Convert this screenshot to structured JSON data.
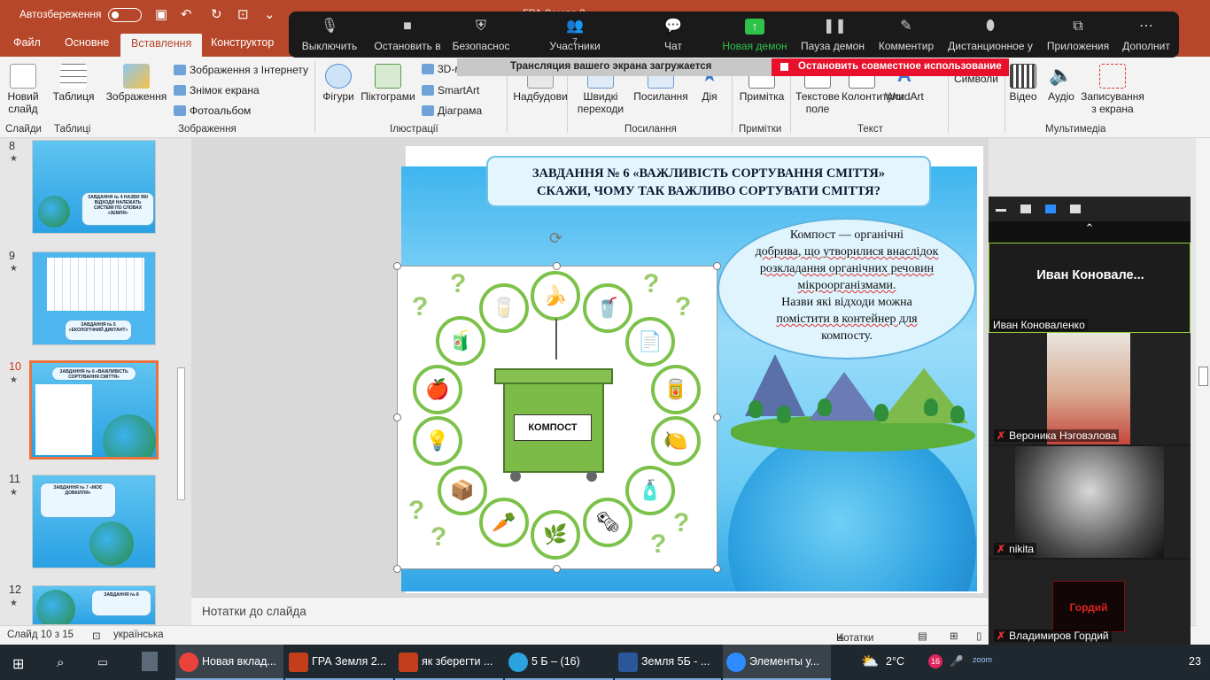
{
  "titlebar": {
    "autosave": "Автозбереження",
    "doc_title": "ГРА Земля 2..."
  },
  "tabs": [
    "Файл",
    "Основне",
    "Вставлення",
    "Конструктор"
  ],
  "ribbon": {
    "new_slide": "Новий слайд",
    "table": "Таблиця",
    "images": "Зображення",
    "online_images": "Зображення з Інтернету",
    "screenshot": "Знімок екрана",
    "photo_album": "Фотоальбом",
    "shapes": "Фігури",
    "icons": "Піктограми",
    "models_3d": "3D-м",
    "smartart": "SmartArt",
    "chart": "Діаграма",
    "addins": "Надбудови",
    "quick_parts": "Швидкі переходи",
    "link": "Посилання",
    "action": "Дія",
    "comment": "Примітка",
    "textbox": "Текстове поле",
    "header_footer": "Колонтитули",
    "wordart": "WordArt",
    "symbols": "Символи",
    "video": "Відео",
    "audio": "Аудіо",
    "screen_recording": "Записування з екрана",
    "groups": {
      "slides": "Слайди",
      "tables": "Таблиці",
      "images": "Зображення",
      "illustrations": "Ілюстрації",
      "links": "Посилання",
      "comments": "Примітки",
      "text": "Текст",
      "media": "Мультимедіа"
    }
  },
  "zoom": {
    "toolbar": [
      {
        "label": "Выключить",
        "icon": "microphone-icon"
      },
      {
        "label": "Остановить в",
        "icon": "video-camera-icon"
      },
      {
        "label": "Безопаснос",
        "icon": "shield-icon"
      },
      {
        "label": "Участники",
        "icon": "participants-icon",
        "count": "7"
      },
      {
        "label": "Чат",
        "icon": "chat-icon"
      },
      {
        "label": "Новая демон",
        "icon": "share-screen-icon"
      },
      {
        "label": "Пауза демон",
        "icon": "pause-icon"
      },
      {
        "label": "Комментир",
        "icon": "pen-icon"
      },
      {
        "label": "Дистанционное у",
        "icon": "mouse-icon"
      },
      {
        "label": "Приложения",
        "icon": "apps-icon"
      },
      {
        "label": "Дополнит",
        "icon": "more-icon"
      }
    ],
    "share_loading": "Трансляция вашего экрана загружается",
    "stop_share": "Остановить совместное использование",
    "participants": [
      {
        "name": "Иван Коноваленко",
        "big_name": "Иван  Коновале...",
        "muted": false
      },
      {
        "name": "Вероника Нэговэлова",
        "muted": true
      },
      {
        "name": "nikita",
        "muted": true
      },
      {
        "name": "Владимиров Гордий",
        "muted": true,
        "badge": "Гордий"
      }
    ]
  },
  "slides": [
    {
      "num": "8",
      "caption": "ЗАВДАННЯ № 4 НАЗВИ ЯКІ ВІДХОДИ НАЛЕЖАТЬ СИСТЕМІ ПО СЛОВАХ «ЗЕМЛЯ»"
    },
    {
      "num": "9",
      "caption": "ЗАВДАННЯ № 5 «ЕКОЛОГІЧНИЙ ДИКТАНТ»"
    },
    {
      "num": "10",
      "caption": "ЗАВДАННЯ № 6 «ВАЖЛИВІСТЬ СОРТУВАННЯ СМІТТЯ»"
    },
    {
      "num": "11",
      "caption": "ЗАВДАННЯ № 7 «МОЄ ДОВКІЛЛЯ»"
    },
    {
      "num": "12",
      "caption": "ЗАВДАННЯ № 8"
    }
  ],
  "slide": {
    "title_line1": "ЗАВДАННЯ № 6 «ВАЖЛИВІСТЬ СОРТУВАННЯ СМІТТЯ»",
    "title_line2": "СКАЖИ, ЧОМУ ТАК ВАЖЛИВО СОРТУВАТИ СМІТТЯ?",
    "bubble_line1": "Компост — органічні",
    "bubble_line2": "добрива, що утворилися внаслідок",
    "bubble_line3": "розкладання органічних речовин",
    "bubble_line4": "мікроорганізмами.",
    "bubble_line5": "Назви які відходи можна",
    "bubble_line6": "помістити в контейнер для",
    "bubble_line7": "компосту.",
    "bin_label": "КОМПОСТ"
  },
  "notes_placeholder": "Нотатки до слайда",
  "status": {
    "slide_info": "Слайд 10 з 15",
    "language": "українська",
    "notes": "Нотатки"
  },
  "taskbar": {
    "apps": [
      {
        "label": "Новая вклад...",
        "color": "#e9423b"
      },
      {
        "label": "ГРА Земля 2...",
        "color": "#c43e1c"
      },
      {
        "label": "як зберегти ...",
        "color": "#c43e1c"
      },
      {
        "label": "5 Б – (16)",
        "color": "#2aa3e0"
      },
      {
        "label": "Земля 5Б - ...",
        "color": "#2b579a"
      },
      {
        "label": "Элементы у...",
        "color": "#2d8cff"
      }
    ],
    "weather": "2°C",
    "badge": "16",
    "time_fragment": "23"
  }
}
